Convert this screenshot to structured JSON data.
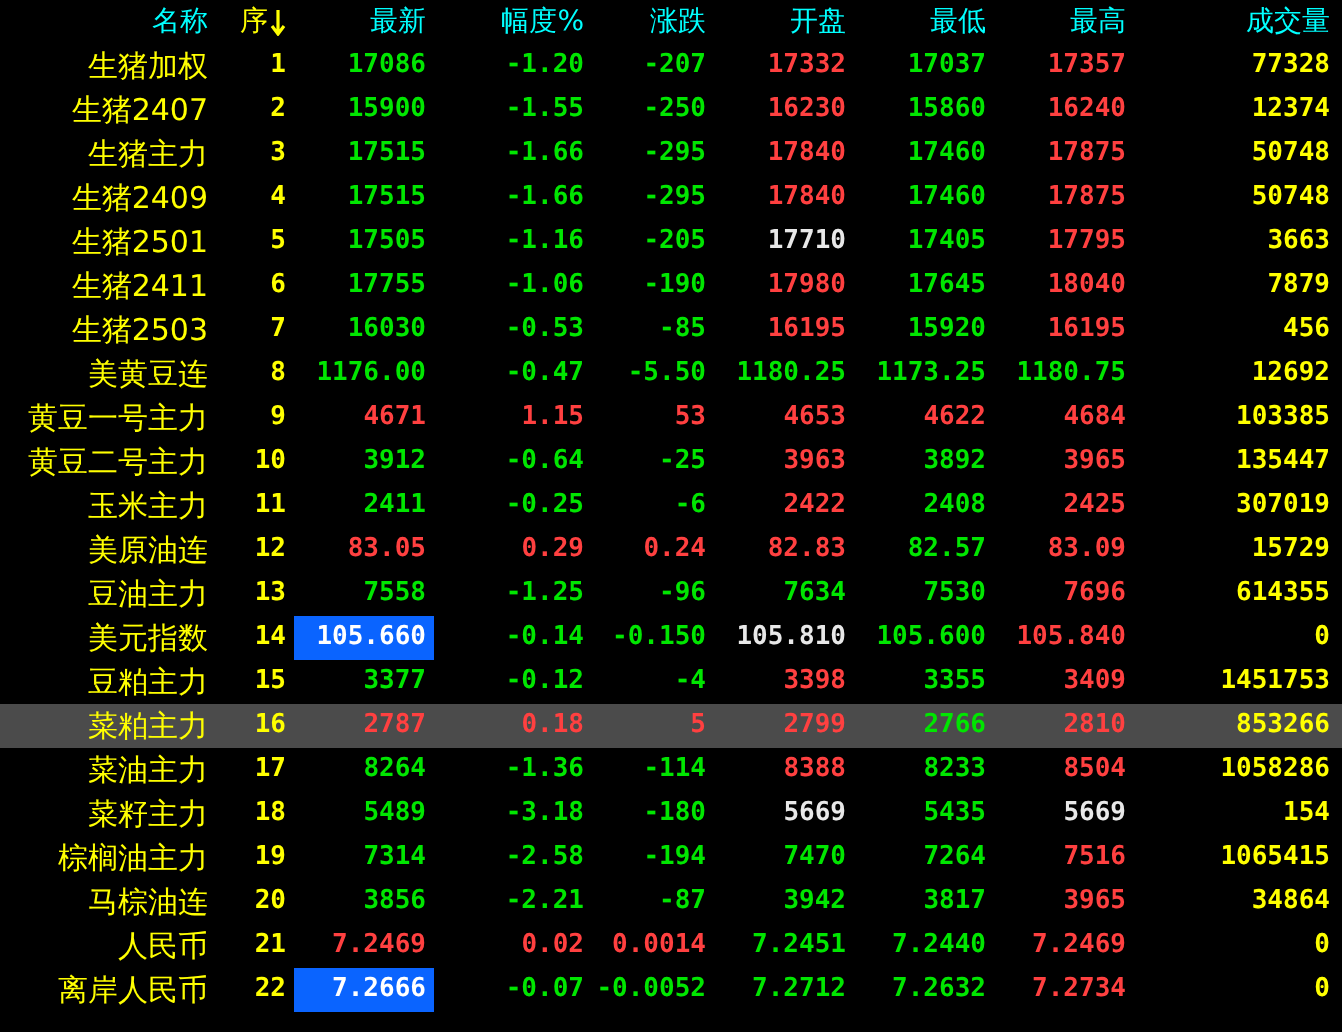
{
  "table": {
    "columns": [
      {
        "label": "名称",
        "sorted": false
      },
      {
        "label": "序",
        "sorted": true
      },
      {
        "label": "最新",
        "sorted": false
      },
      {
        "label": "幅度%",
        "sorted": false
      },
      {
        "label": "涨跌",
        "sorted": false
      },
      {
        "label": "开盘",
        "sorted": false
      },
      {
        "label": "最低",
        "sorted": false
      },
      {
        "label": "最高",
        "sorted": false
      },
      {
        "label": "成交量",
        "sorted": false
      }
    ],
    "rows": [
      {
        "selected": false,
        "cells": [
          {
            "text": "生猪加权",
            "color": "#ffff00",
            "highlighted": false
          },
          {
            "text": "1",
            "color": "#ffff00",
            "highlighted": false
          },
          {
            "text": "17086",
            "color": "#00e600",
            "highlighted": false
          },
          {
            "text": "-1.20",
            "color": "#00e600",
            "highlighted": false
          },
          {
            "text": "-207",
            "color": "#00e600",
            "highlighted": false
          },
          {
            "text": "17332",
            "color": "#ff4040",
            "highlighted": false
          },
          {
            "text": "17037",
            "color": "#00e600",
            "highlighted": false
          },
          {
            "text": "17357",
            "color": "#ff4040",
            "highlighted": false
          },
          {
            "text": "77328",
            "color": "#ffff00",
            "highlighted": false
          }
        ]
      },
      {
        "selected": false,
        "cells": [
          {
            "text": "生猪2407",
            "color": "#ffff00",
            "highlighted": false
          },
          {
            "text": "2",
            "color": "#ffff00",
            "highlighted": false
          },
          {
            "text": "15900",
            "color": "#00e600",
            "highlighted": false
          },
          {
            "text": "-1.55",
            "color": "#00e600",
            "highlighted": false
          },
          {
            "text": "-250",
            "color": "#00e600",
            "highlighted": false
          },
          {
            "text": "16230",
            "color": "#ff4040",
            "highlighted": false
          },
          {
            "text": "15860",
            "color": "#00e600",
            "highlighted": false
          },
          {
            "text": "16240",
            "color": "#ff4040",
            "highlighted": false
          },
          {
            "text": "12374",
            "color": "#ffff00",
            "highlighted": false
          }
        ]
      },
      {
        "selected": false,
        "cells": [
          {
            "text": "生猪主力",
            "color": "#ffff00",
            "highlighted": false
          },
          {
            "text": "3",
            "color": "#ffff00",
            "highlighted": false
          },
          {
            "text": "17515",
            "color": "#00e600",
            "highlighted": false
          },
          {
            "text": "-1.66",
            "color": "#00e600",
            "highlighted": false
          },
          {
            "text": "-295",
            "color": "#00e600",
            "highlighted": false
          },
          {
            "text": "17840",
            "color": "#ff4040",
            "highlighted": false
          },
          {
            "text": "17460",
            "color": "#00e600",
            "highlighted": false
          },
          {
            "text": "17875",
            "color": "#ff4040",
            "highlighted": false
          },
          {
            "text": "50748",
            "color": "#ffff00",
            "highlighted": false
          }
        ]
      },
      {
        "selected": false,
        "cells": [
          {
            "text": "生猪2409",
            "color": "#ffff00",
            "highlighted": false
          },
          {
            "text": "4",
            "color": "#ffff00",
            "highlighted": false
          },
          {
            "text": "17515",
            "color": "#00e600",
            "highlighted": false
          },
          {
            "text": "-1.66",
            "color": "#00e600",
            "highlighted": false
          },
          {
            "text": "-295",
            "color": "#00e600",
            "highlighted": false
          },
          {
            "text": "17840",
            "color": "#ff4040",
            "highlighted": false
          },
          {
            "text": "17460",
            "color": "#00e600",
            "highlighted": false
          },
          {
            "text": "17875",
            "color": "#ff4040",
            "highlighted": false
          },
          {
            "text": "50748",
            "color": "#ffff00",
            "highlighted": false
          }
        ]
      },
      {
        "selected": false,
        "cells": [
          {
            "text": "生猪2501",
            "color": "#ffff00",
            "highlighted": false
          },
          {
            "text": "5",
            "color": "#ffff00",
            "highlighted": false
          },
          {
            "text": "17505",
            "color": "#00e600",
            "highlighted": false
          },
          {
            "text": "-1.16",
            "color": "#00e600",
            "highlighted": false
          },
          {
            "text": "-205",
            "color": "#00e600",
            "highlighted": false
          },
          {
            "text": "17710",
            "color": "#e8e8e8",
            "highlighted": false
          },
          {
            "text": "17405",
            "color": "#00e600",
            "highlighted": false
          },
          {
            "text": "17795",
            "color": "#ff4040",
            "highlighted": false
          },
          {
            "text": "3663",
            "color": "#ffff00",
            "highlighted": false
          }
        ]
      },
      {
        "selected": false,
        "cells": [
          {
            "text": "生猪2411",
            "color": "#ffff00",
            "highlighted": false
          },
          {
            "text": "6",
            "color": "#ffff00",
            "highlighted": false
          },
          {
            "text": "17755",
            "color": "#00e600",
            "highlighted": false
          },
          {
            "text": "-1.06",
            "color": "#00e600",
            "highlighted": false
          },
          {
            "text": "-190",
            "color": "#00e600",
            "highlighted": false
          },
          {
            "text": "17980",
            "color": "#ff4040",
            "highlighted": false
          },
          {
            "text": "17645",
            "color": "#00e600",
            "highlighted": false
          },
          {
            "text": "18040",
            "color": "#ff4040",
            "highlighted": false
          },
          {
            "text": "7879",
            "color": "#ffff00",
            "highlighted": false
          }
        ]
      },
      {
        "selected": false,
        "cells": [
          {
            "text": "生猪2503",
            "color": "#ffff00",
            "highlighted": false
          },
          {
            "text": "7",
            "color": "#ffff00",
            "highlighted": false
          },
          {
            "text": "16030",
            "color": "#00e600",
            "highlighted": false
          },
          {
            "text": "-0.53",
            "color": "#00e600",
            "highlighted": false
          },
          {
            "text": "-85",
            "color": "#00e600",
            "highlighted": false
          },
          {
            "text": "16195",
            "color": "#ff4040",
            "highlighted": false
          },
          {
            "text": "15920",
            "color": "#00e600",
            "highlighted": false
          },
          {
            "text": "16195",
            "color": "#ff4040",
            "highlighted": false
          },
          {
            "text": "456",
            "color": "#ffff00",
            "highlighted": false
          }
        ]
      },
      {
        "selected": false,
        "cells": [
          {
            "text": "美黄豆连",
            "color": "#ffff00",
            "highlighted": false
          },
          {
            "text": "8",
            "color": "#ffff00",
            "highlighted": false
          },
          {
            "text": "1176.00",
            "color": "#00e600",
            "highlighted": false
          },
          {
            "text": "-0.47",
            "color": "#00e600",
            "highlighted": false
          },
          {
            "text": "-5.50",
            "color": "#00e600",
            "highlighted": false
          },
          {
            "text": "1180.25",
            "color": "#00e600",
            "highlighted": false
          },
          {
            "text": "1173.25",
            "color": "#00e600",
            "highlighted": false
          },
          {
            "text": "1180.75",
            "color": "#00e600",
            "highlighted": false
          },
          {
            "text": "12692",
            "color": "#ffff00",
            "highlighted": false
          }
        ]
      },
      {
        "selected": false,
        "cells": [
          {
            "text": "黄豆一号主力",
            "color": "#ffff00",
            "highlighted": false
          },
          {
            "text": "9",
            "color": "#ffff00",
            "highlighted": false
          },
          {
            "text": "4671",
            "color": "#ff4040",
            "highlighted": false
          },
          {
            "text": "1.15",
            "color": "#ff4040",
            "highlighted": false
          },
          {
            "text": "53",
            "color": "#ff4040",
            "highlighted": false
          },
          {
            "text": "4653",
            "color": "#ff4040",
            "highlighted": false
          },
          {
            "text": "4622",
            "color": "#ff4040",
            "highlighted": false
          },
          {
            "text": "4684",
            "color": "#ff4040",
            "highlighted": false
          },
          {
            "text": "103385",
            "color": "#ffff00",
            "highlighted": false
          }
        ]
      },
      {
        "selected": false,
        "cells": [
          {
            "text": "黄豆二号主力",
            "color": "#ffff00",
            "highlighted": false
          },
          {
            "text": "10",
            "color": "#ffff00",
            "highlighted": false
          },
          {
            "text": "3912",
            "color": "#00e600",
            "highlighted": false
          },
          {
            "text": "-0.64",
            "color": "#00e600",
            "highlighted": false
          },
          {
            "text": "-25",
            "color": "#00e600",
            "highlighted": false
          },
          {
            "text": "3963",
            "color": "#ff4040",
            "highlighted": false
          },
          {
            "text": "3892",
            "color": "#00e600",
            "highlighted": false
          },
          {
            "text": "3965",
            "color": "#ff4040",
            "highlighted": false
          },
          {
            "text": "135447",
            "color": "#ffff00",
            "highlighted": false
          }
        ]
      },
      {
        "selected": false,
        "cells": [
          {
            "text": "玉米主力",
            "color": "#ffff00",
            "highlighted": false
          },
          {
            "text": "11",
            "color": "#ffff00",
            "highlighted": false
          },
          {
            "text": "2411",
            "color": "#00e600",
            "highlighted": false
          },
          {
            "text": "-0.25",
            "color": "#00e600",
            "highlighted": false
          },
          {
            "text": "-6",
            "color": "#00e600",
            "highlighted": false
          },
          {
            "text": "2422",
            "color": "#ff4040",
            "highlighted": false
          },
          {
            "text": "2408",
            "color": "#00e600",
            "highlighted": false
          },
          {
            "text": "2425",
            "color": "#ff4040",
            "highlighted": false
          },
          {
            "text": "307019",
            "color": "#ffff00",
            "highlighted": false
          }
        ]
      },
      {
        "selected": false,
        "cells": [
          {
            "text": "美原油连",
            "color": "#ffff00",
            "highlighted": false
          },
          {
            "text": "12",
            "color": "#ffff00",
            "highlighted": false
          },
          {
            "text": "83.05",
            "color": "#ff4040",
            "highlighted": false
          },
          {
            "text": "0.29",
            "color": "#ff4040",
            "highlighted": false
          },
          {
            "text": "0.24",
            "color": "#ff4040",
            "highlighted": false
          },
          {
            "text": "82.83",
            "color": "#ff4040",
            "highlighted": false
          },
          {
            "text": "82.57",
            "color": "#00e600",
            "highlighted": false
          },
          {
            "text": "83.09",
            "color": "#ff4040",
            "highlighted": false
          },
          {
            "text": "15729",
            "color": "#ffff00",
            "highlighted": false
          }
        ]
      },
      {
        "selected": false,
        "cells": [
          {
            "text": "豆油主力",
            "color": "#ffff00",
            "highlighted": false
          },
          {
            "text": "13",
            "color": "#ffff00",
            "highlighted": false
          },
          {
            "text": "7558",
            "color": "#00e600",
            "highlighted": false
          },
          {
            "text": "-1.25",
            "color": "#00e600",
            "highlighted": false
          },
          {
            "text": "-96",
            "color": "#00e600",
            "highlighted": false
          },
          {
            "text": "7634",
            "color": "#00e600",
            "highlighted": false
          },
          {
            "text": "7530",
            "color": "#00e600",
            "highlighted": false
          },
          {
            "text": "7696",
            "color": "#ff4040",
            "highlighted": false
          },
          {
            "text": "614355",
            "color": "#ffff00",
            "highlighted": false
          }
        ]
      },
      {
        "selected": false,
        "cells": [
          {
            "text": "美元指数",
            "color": "#ffff00",
            "highlighted": false
          },
          {
            "text": "14",
            "color": "#ffff00",
            "highlighted": false
          },
          {
            "text": "105.660",
            "color": "#ffffff",
            "highlighted": true
          },
          {
            "text": "-0.14",
            "color": "#00e600",
            "highlighted": false
          },
          {
            "text": "-0.150",
            "color": "#00e600",
            "highlighted": false
          },
          {
            "text": "105.810",
            "color": "#e8e8e8",
            "highlighted": false
          },
          {
            "text": "105.600",
            "color": "#00e600",
            "highlighted": false
          },
          {
            "text": "105.840",
            "color": "#ff4040",
            "highlighted": false
          },
          {
            "text": "0",
            "color": "#ffff00",
            "highlighted": false
          }
        ]
      },
      {
        "selected": false,
        "cells": [
          {
            "text": "豆粕主力",
            "color": "#ffff00",
            "highlighted": false
          },
          {
            "text": "15",
            "color": "#ffff00",
            "highlighted": false
          },
          {
            "text": "3377",
            "color": "#00e600",
            "highlighted": false
          },
          {
            "text": "-0.12",
            "color": "#00e600",
            "highlighted": false
          },
          {
            "text": "-4",
            "color": "#00e600",
            "highlighted": false
          },
          {
            "text": "3398",
            "color": "#ff4040",
            "highlighted": false
          },
          {
            "text": "3355",
            "color": "#00e600",
            "highlighted": false
          },
          {
            "text": "3409",
            "color": "#ff4040",
            "highlighted": false
          },
          {
            "text": "1451753",
            "color": "#ffff00",
            "highlighted": false
          }
        ]
      },
      {
        "selected": true,
        "cells": [
          {
            "text": "菜粕主力",
            "color": "#ffff00",
            "highlighted": false
          },
          {
            "text": "16",
            "color": "#ffff00",
            "highlighted": false
          },
          {
            "text": "2787",
            "color": "#ff4040",
            "highlighted": false
          },
          {
            "text": "0.18",
            "color": "#ff4040",
            "highlighted": false
          },
          {
            "text": "5",
            "color": "#ff4040",
            "highlighted": false
          },
          {
            "text": "2799",
            "color": "#ff4040",
            "highlighted": false
          },
          {
            "text": "2766",
            "color": "#00e600",
            "highlighted": false
          },
          {
            "text": "2810",
            "color": "#ff4040",
            "highlighted": false
          },
          {
            "text": "853266",
            "color": "#ffff00",
            "highlighted": false
          }
        ]
      },
      {
        "selected": false,
        "cells": [
          {
            "text": "菜油主力",
            "color": "#ffff00",
            "highlighted": false
          },
          {
            "text": "17",
            "color": "#ffff00",
            "highlighted": false
          },
          {
            "text": "8264",
            "color": "#00e600",
            "highlighted": false
          },
          {
            "text": "-1.36",
            "color": "#00e600",
            "highlighted": false
          },
          {
            "text": "-114",
            "color": "#00e600",
            "highlighted": false
          },
          {
            "text": "8388",
            "color": "#ff4040",
            "highlighted": false
          },
          {
            "text": "8233",
            "color": "#00e600",
            "highlighted": false
          },
          {
            "text": "8504",
            "color": "#ff4040",
            "highlighted": false
          },
          {
            "text": "1058286",
            "color": "#ffff00",
            "highlighted": false
          }
        ]
      },
      {
        "selected": false,
        "cells": [
          {
            "text": "菜籽主力",
            "color": "#ffff00",
            "highlighted": false
          },
          {
            "text": "18",
            "color": "#ffff00",
            "highlighted": false
          },
          {
            "text": "5489",
            "color": "#00e600",
            "highlighted": false
          },
          {
            "text": "-3.18",
            "color": "#00e600",
            "highlighted": false
          },
          {
            "text": "-180",
            "color": "#00e600",
            "highlighted": false
          },
          {
            "text": "5669",
            "color": "#e8e8e8",
            "highlighted": false
          },
          {
            "text": "5435",
            "color": "#00e600",
            "highlighted": false
          },
          {
            "text": "5669",
            "color": "#e8e8e8",
            "highlighted": false
          },
          {
            "text": "154",
            "color": "#ffff00",
            "highlighted": false
          }
        ]
      },
      {
        "selected": false,
        "cells": [
          {
            "text": "棕榈油主力",
            "color": "#ffff00",
            "highlighted": false
          },
          {
            "text": "19",
            "color": "#ffff00",
            "highlighted": false
          },
          {
            "text": "7314",
            "color": "#00e600",
            "highlighted": false
          },
          {
            "text": "-2.58",
            "color": "#00e600",
            "highlighted": false
          },
          {
            "text": "-194",
            "color": "#00e600",
            "highlighted": false
          },
          {
            "text": "7470",
            "color": "#00e600",
            "highlighted": false
          },
          {
            "text": "7264",
            "color": "#00e600",
            "highlighted": false
          },
          {
            "text": "7516",
            "color": "#ff4040",
            "highlighted": false
          },
          {
            "text": "1065415",
            "color": "#ffff00",
            "highlighted": false
          }
        ]
      },
      {
        "selected": false,
        "cells": [
          {
            "text": "马棕油连",
            "color": "#ffff00",
            "highlighted": false
          },
          {
            "text": "20",
            "color": "#ffff00",
            "highlighted": false
          },
          {
            "text": "3856",
            "color": "#00e600",
            "highlighted": false
          },
          {
            "text": "-2.21",
            "color": "#00e600",
            "highlighted": false
          },
          {
            "text": "-87",
            "color": "#00e600",
            "highlighted": false
          },
          {
            "text": "3942",
            "color": "#00e600",
            "highlighted": false
          },
          {
            "text": "3817",
            "color": "#00e600",
            "highlighted": false
          },
          {
            "text": "3965",
            "color": "#ff4040",
            "highlighted": false
          },
          {
            "text": "34864",
            "color": "#ffff00",
            "highlighted": false
          }
        ]
      },
      {
        "selected": false,
        "cells": [
          {
            "text": "人民币",
            "color": "#ffff00",
            "highlighted": false
          },
          {
            "text": "21",
            "color": "#ffff00",
            "highlighted": false
          },
          {
            "text": "7.2469",
            "color": "#ff4040",
            "highlighted": false
          },
          {
            "text": "0.02",
            "color": "#ff4040",
            "highlighted": false
          },
          {
            "text": "0.0014",
            "color": "#ff4040",
            "highlighted": false
          },
          {
            "text": "7.2451",
            "color": "#00e600",
            "highlighted": false
          },
          {
            "text": "7.2440",
            "color": "#00e600",
            "highlighted": false
          },
          {
            "text": "7.2469",
            "color": "#ff4040",
            "highlighted": false
          },
          {
            "text": "0",
            "color": "#ffff00",
            "highlighted": false
          }
        ]
      },
      {
        "selected": false,
        "cells": [
          {
            "text": "离岸人民币",
            "color": "#ffff00",
            "highlighted": false
          },
          {
            "text": "22",
            "color": "#ffff00",
            "highlighted": false
          },
          {
            "text": "7.2666",
            "color": "#ffffff",
            "highlighted": true
          },
          {
            "text": "-0.07",
            "color": "#00e600",
            "highlighted": false
          },
          {
            "text": "-0.0052",
            "color": "#00e600",
            "highlighted": false
          },
          {
            "text": "7.2712",
            "color": "#00e600",
            "highlighted": false
          },
          {
            "text": "7.2632",
            "color": "#00e600",
            "highlighted": false
          },
          {
            "text": "7.2734",
            "color": "#ff4040",
            "highlighted": false
          },
          {
            "text": "0",
            "color": "#ffff00",
            "highlighted": false
          }
        ]
      }
    ]
  }
}
